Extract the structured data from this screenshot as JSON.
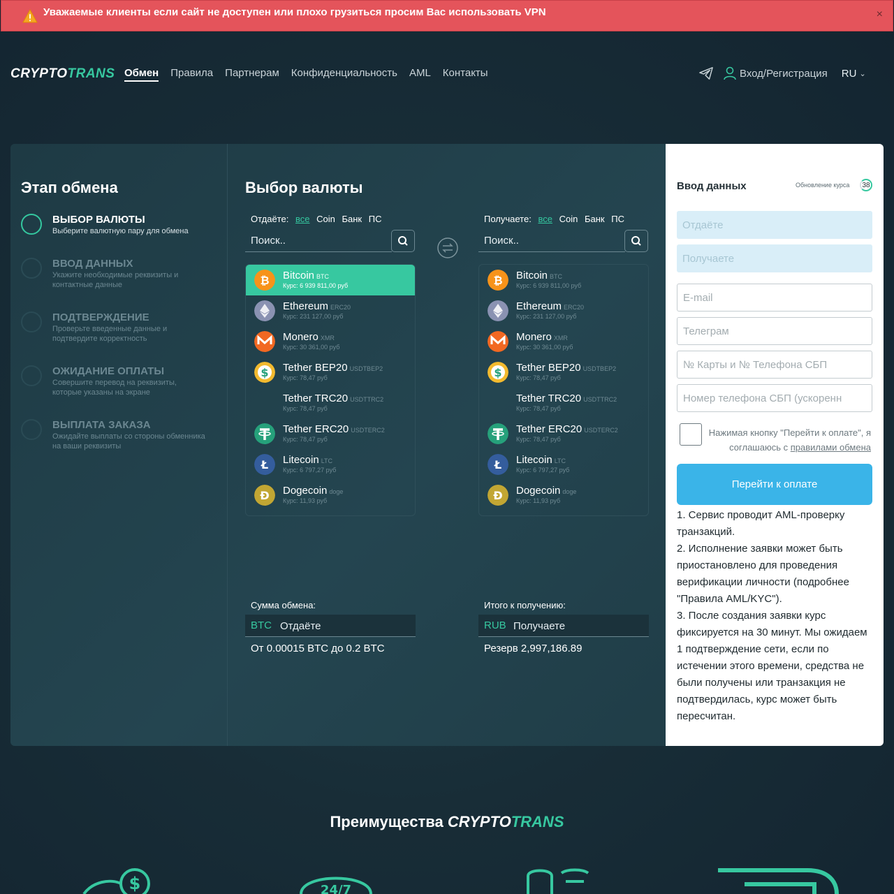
{
  "banner": {
    "text": "Уважаемые клиенты если сайт не доступен или плохо грузиться просим Вас использовать VPN",
    "close": "×"
  },
  "logo": {
    "part1": "CRYPTO",
    "part2": "TRANS"
  },
  "nav": {
    "items": [
      "Обмен",
      "Правила",
      "Партнерам",
      "Конфиденциальность",
      "AML",
      "Контакты"
    ],
    "login": "Вход/Регистрация",
    "lang": "RU"
  },
  "steps": {
    "title": "Этап обмена",
    "items": [
      {
        "title": "Выбор валюты",
        "desc": "Выберите валютную пару для обмена"
      },
      {
        "title": "Ввод данных",
        "desc": "Укажите необходимые реквизиты и контактные данные"
      },
      {
        "title": "Подтверждение",
        "desc": "Проверьте введенные данные и подтвердите корректность"
      },
      {
        "title": "Ожидание оплаты",
        "desc": "Совершите перевод на реквизиты, которые указаны на экране"
      },
      {
        "title": "Выплата заказа",
        "desc": "Ожидайте выплаты со стороны обменника на ваши реквизиты"
      }
    ]
  },
  "currency": {
    "title": "Выбор валюты",
    "give": {
      "label": "Отдаёте:",
      "filters": [
        "все",
        "Coin",
        "Банк",
        "ПС"
      ],
      "search_placeholder": "Поиск..",
      "sum_label": "Сумма обмена:",
      "sum_code": "BTC",
      "sum_placeholder": "Отдаёте",
      "note": "От 0.00015 BTC до 0.2 BTC"
    },
    "get": {
      "label": "Получаете:",
      "filters": [
        "все",
        "Coin",
        "Банк",
        "ПС"
      ],
      "search_placeholder": "Поиск..",
      "sum_label": "Итого к получению:",
      "sum_code": "RUB",
      "sum_placeholder": "Получаете",
      "note": "Резерв 2,997,186.89"
    },
    "coins": [
      {
        "name": "Bitcoin",
        "ticker": "BTC",
        "rate": "Курс: 6 939 811,00 руб",
        "icon": "bitcoin-icon",
        "color": "#f7931a"
      },
      {
        "name": "Ethereum",
        "ticker": "ERC20",
        "rate": "Курс: 231 127,00 руб",
        "icon": "ethereum-icon",
        "color": "#8a92b2"
      },
      {
        "name": "Monero",
        "ticker": "XMR",
        "rate": "Курс: 30 361,00 руб",
        "icon": "monero-icon",
        "color": "#f26822"
      },
      {
        "name": "Tether BEP20",
        "ticker": "USDTBEP2",
        "rate": "Курс: 78,47 руб",
        "icon": "tether-bep20-icon",
        "color": "#f3ba2f"
      },
      {
        "name": "Tether TRC20",
        "ticker": "USDTTRC2",
        "rate": "Курс: 78,47 руб",
        "icon": "tether-trc20-icon",
        "color": ""
      },
      {
        "name": "Tether ERC20",
        "ticker": "USDTERC2",
        "rate": "Курс: 78,47 руб",
        "icon": "tether-erc20-icon",
        "color": "#26a17b"
      },
      {
        "name": "Litecoin",
        "ticker": "LTC",
        "rate": "Курс: 6 797,27 руб",
        "icon": "litecoin-icon",
        "color": "#345d9d"
      },
      {
        "name": "Dogecoin",
        "ticker": "doge",
        "rate": "Курс: 11,93 руб",
        "icon": "dogecoin-icon",
        "color": "#c2a633"
      }
    ]
  },
  "form": {
    "title": "Ввод данных",
    "update_label": "Обновление курса",
    "timer": "38",
    "give_placeholder": "Отдаёте",
    "get_placeholder": "Получаете",
    "email_placeholder": "E-mail",
    "telegram_placeholder": "Телеграм",
    "card_placeholder": "№ Карты и № Телефона СБП",
    "phone_placeholder": "Номер телефона СБП (ускоренн",
    "agree_text": "Нажимая кнопку \"Перейти к оплате\", я соглашаюсь с",
    "agree_link": "правилами обмена",
    "pay_button": "Перейти к оплате",
    "notes": [
      "1. Сервис проводит AML-проверку транзакций.",
      "2. Исполнение заявки может быть приостановлено для проведения верификации личности (подробнее \"Правила AML/KYC\").",
      "3. После создания заявки курс фиксируется на 30 минут. Мы ожидаем 1 подтверждение сети, если по истечении этого времени, средства не были получены или транзакция не подтвердилась, курс может быть пересчитан."
    ]
  },
  "advantages": {
    "title": "Преимущества",
    "brand1": "CRYPTO",
    "brand2": "TRANS"
  },
  "colors": {
    "accent": "#37c8a0",
    "button": "#3ab4e8",
    "banner": "#e4545b"
  }
}
